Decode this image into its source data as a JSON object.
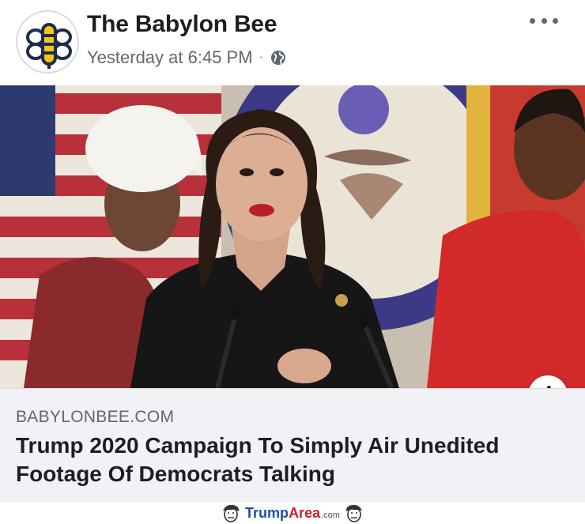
{
  "post": {
    "page_name": "The Babylon Bee",
    "timestamp": "Yesterday at 6:45 PM",
    "separator": "·",
    "privacy_icon": "globe-icon",
    "more_icon": "more-options-icon"
  },
  "photo": {
    "info_label": "i"
  },
  "link": {
    "domain": "BABYLONBEE.COM",
    "title": "Trump 2020 Campaign To Simply Air Unedited Footage Of Democrats Talking"
  },
  "watermark": {
    "trump": "Trump",
    "area": "Area",
    "com": ".com",
    "logo": "trumparea-logo"
  },
  "colors": {
    "name_text": "#1c1e21",
    "meta_text": "#606770",
    "card_bg": "#f0f2f5",
    "bee_yellow": "#f5c518",
    "bee_navy": "#1d2b4f",
    "watermark_blue": "#1f4ea8",
    "watermark_red": "#d01f26"
  }
}
